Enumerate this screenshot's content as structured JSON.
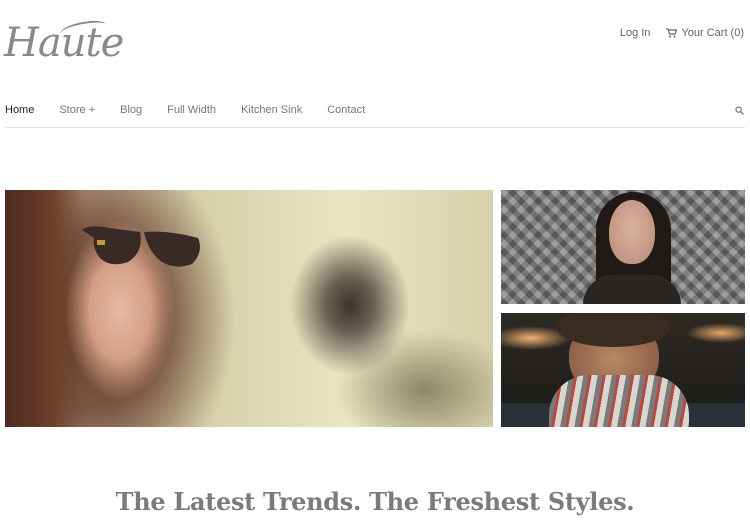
{
  "header": {
    "logo_text": "Haute",
    "login_label": "Log In",
    "cart_label": "Your Cart (0)",
    "cart_icon": "cart-icon"
  },
  "nav": {
    "items": [
      {
        "label": "Home",
        "active": true
      },
      {
        "label": "Store +",
        "active": false
      },
      {
        "label": "Blog",
        "active": false
      },
      {
        "label": "Full Width",
        "active": false
      },
      {
        "label": "Kitchen Sink",
        "active": false
      },
      {
        "label": "Contact",
        "active": false
      }
    ],
    "search_icon": "search-icon"
  },
  "hero": {
    "tagline": "The Latest Trends. The Freshest Styles."
  },
  "colors": {
    "text_dark": "#222222",
    "text_muted": "#777777",
    "divider": "#e2e2e2"
  }
}
